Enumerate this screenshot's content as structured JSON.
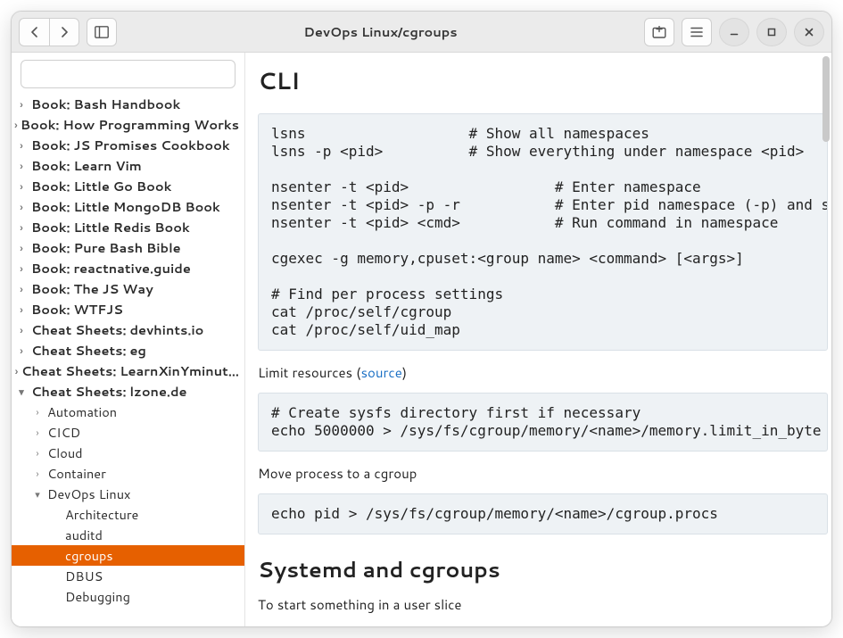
{
  "header": {
    "title": "DevOps Linux/cgroups"
  },
  "search": {
    "placeholder": ""
  },
  "sidebar": {
    "books": [
      "Book: Bash Handbook",
      "Book: How Programming Works",
      "Book: JS Promises Cookbook",
      "Book: Learn Vim",
      "Book: Little Go Book",
      "Book: Little MongoDB Book",
      "Book: Little Redis Book",
      "Book: Pure Bash Bible",
      "Book: reactnative.guide",
      "Book: The JS Way",
      "Book: WTFJS",
      "Cheat Sheets: devhints.io",
      "Cheat Sheets: eg",
      "Cheat Sheets: LearnXinYminut…"
    ],
    "expanded_label": "Cheat Sheets: lzone.de",
    "level1": [
      "Automation",
      "CICD",
      "Cloud",
      "Container"
    ],
    "devops_label": "DevOps Linux",
    "devops_children": [
      "Architecture",
      "auditd",
      "cgroups",
      "DBUS",
      "Debugging"
    ],
    "selected": "cgroups"
  },
  "content": {
    "h_cli": "CLI",
    "code1": "lsns                   # Show all namespaces\nlsns -p <pid>          # Show everything under namespace <pid>\n\nnsenter -t <pid>                 # Enter namespace\nnsenter -t <pid> -p -r           # Enter pid namespace (-p) and se\nnsenter -t <pid> <cmd>           # Run command in namespace\n\ncgexec -g memory,cpuset:<group name> <command> [<args>]\n\n# Find per process settings\ncat /proc/self/cgroup\ncat /proc/self/uid_map",
    "limit_pre": "Limit resources (",
    "limit_link": "source",
    "limit_post": ")",
    "code2": "# Create sysfs directory first if necessary\necho 5000000 > /sys/fs/cgroup/memory/<name>/memory.limit_in_byte",
    "move_text": "Move process to a cgroup",
    "code3": "echo pid > /sys/fs/cgroup/memory/<name>/cgroup.procs",
    "h_systemd": "Systemd and cgroups",
    "start_text": "To start something in a user slice"
  }
}
